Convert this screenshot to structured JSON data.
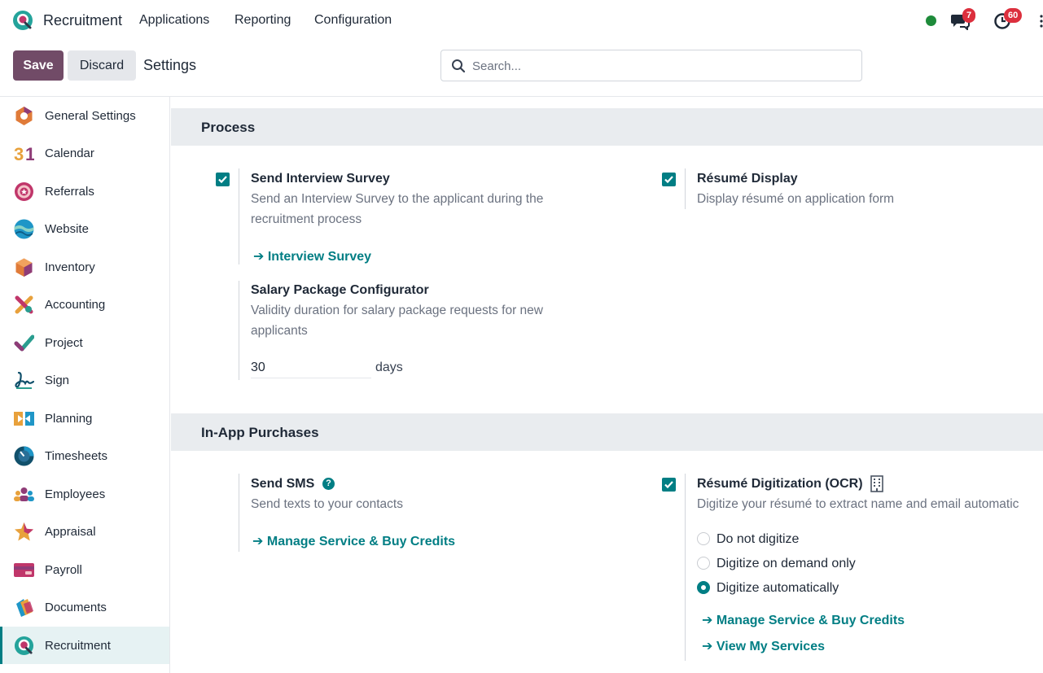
{
  "topnav": {
    "app_name": "Recruitment",
    "menu": [
      "Applications",
      "Reporting",
      "Configuration"
    ],
    "chat_badge": "7",
    "activity_badge": "60",
    "status_color": "#1e8b3a"
  },
  "controls": {
    "save_label": "Save",
    "discard_label": "Discard",
    "breadcrumb": "Settings",
    "search_placeholder": "Search..."
  },
  "sidebar": {
    "items": [
      {
        "label": "General Settings",
        "icon": "general-settings-icon"
      },
      {
        "label": "Calendar",
        "icon": "calendar-icon"
      },
      {
        "label": "Referrals",
        "icon": "referrals-icon"
      },
      {
        "label": "Website",
        "icon": "website-icon"
      },
      {
        "label": "Inventory",
        "icon": "inventory-icon"
      },
      {
        "label": "Accounting",
        "icon": "accounting-icon"
      },
      {
        "label": "Project",
        "icon": "project-icon"
      },
      {
        "label": "Sign",
        "icon": "sign-icon"
      },
      {
        "label": "Planning",
        "icon": "planning-icon"
      },
      {
        "label": "Timesheets",
        "icon": "timesheets-icon"
      },
      {
        "label": "Employees",
        "icon": "employees-icon"
      },
      {
        "label": "Appraisal",
        "icon": "appraisal-icon"
      },
      {
        "label": "Payroll",
        "icon": "payroll-icon"
      },
      {
        "label": "Documents",
        "icon": "documents-icon"
      },
      {
        "label": "Recruitment",
        "icon": "recruitment-icon",
        "active": true
      }
    ]
  },
  "process": {
    "title": "Process",
    "interview_survey": {
      "title": "Send Interview Survey",
      "desc": "Send an Interview Survey to the applicant during the recruitment process",
      "link": "Interview Survey",
      "checked": true
    },
    "resume_display": {
      "title": "Résumé Display",
      "desc": "Display résumé on application form",
      "checked": true
    },
    "salary": {
      "title": "Salary Package Configurator",
      "desc": "Validity duration for salary package requests for new applicants",
      "value": "30",
      "unit": "days"
    }
  },
  "purchases": {
    "title": "In-App Purchases",
    "sms": {
      "title": "Send SMS",
      "help": "?",
      "desc": "Send texts to your contacts",
      "link": "Manage Service & Buy Credits"
    },
    "ocr": {
      "title": "Résumé Digitization (OCR)",
      "desc": "Digitize your résumé to extract name and email automatic",
      "checked": true,
      "options": [
        "Do not digitize",
        "Digitize on demand only",
        "Digitize automatically"
      ],
      "selected": "Digitize automatically",
      "link_manage": "Manage Service & Buy Credits",
      "link_services": "View My Services"
    }
  },
  "colors": {
    "brand": "#714b67",
    "accent": "#017e84",
    "badge": "#dc2f3d"
  }
}
